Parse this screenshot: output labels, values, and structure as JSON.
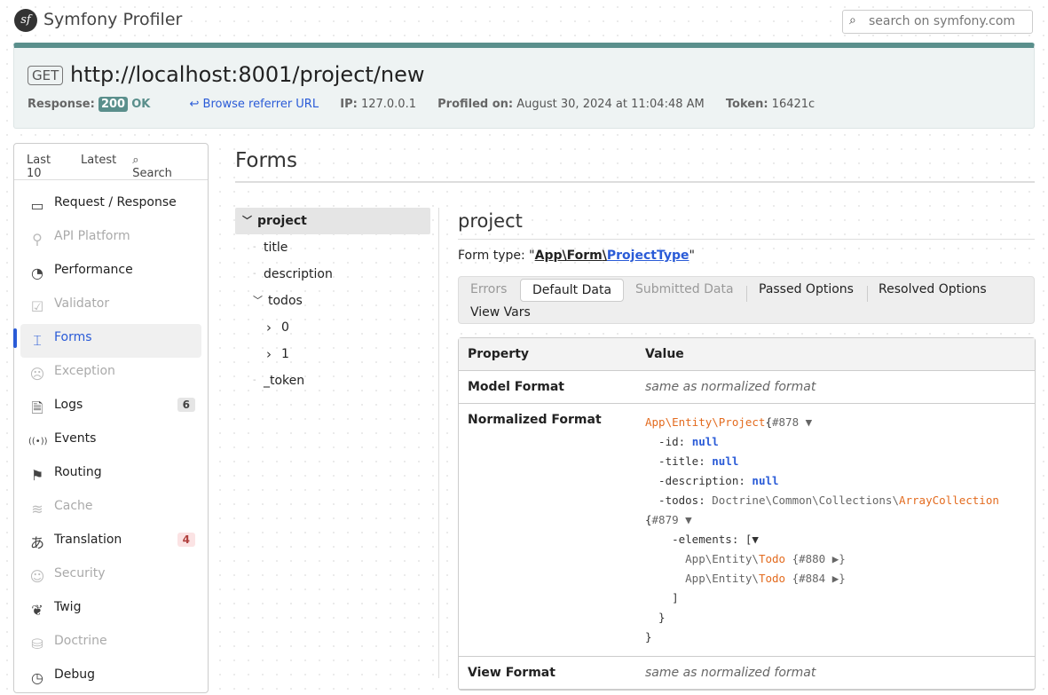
{
  "header": {
    "brand": "Symfony Profiler",
    "logo": "sf",
    "search_placeholder": "search on symfony.com"
  },
  "summary": {
    "method": "GET",
    "url": "http://localhost:8001/project/new",
    "response_label": "Response:",
    "status_code": "200",
    "status_text": "OK",
    "referrer": "Browse referrer URL",
    "ip_label": "IP:",
    "ip": "127.0.0.1",
    "profiled_label": "Profiled on:",
    "profiled": "August 30, 2024 at 11:04:48 AM",
    "token_label": "Token:",
    "token": "16421c",
    "accent": "#5a8f8c"
  },
  "sidebar": {
    "top": [
      "Last 10",
      "Latest",
      "Search"
    ],
    "items": [
      {
        "label": "Request / Response",
        "icon": "window-icon",
        "glyph": "▭",
        "state": "normal"
      },
      {
        "label": "API Platform",
        "icon": "spider-icon",
        "glyph": "⚲",
        "state": "disabled"
      },
      {
        "label": "Performance",
        "icon": "clock-chart-icon",
        "glyph": "◔",
        "state": "normal"
      },
      {
        "label": "Validator",
        "icon": "clipboard-check-icon",
        "glyph": "☑",
        "state": "disabled"
      },
      {
        "label": "Forms",
        "icon": "form-icon",
        "glyph": "⌶",
        "state": "selected"
      },
      {
        "label": "Exception",
        "icon": "ghost-icon",
        "glyph": "☹",
        "state": "disabled"
      },
      {
        "label": "Logs",
        "icon": "file-alert-icon",
        "glyph": "🗎",
        "state": "normal",
        "count": "6"
      },
      {
        "label": "Events",
        "icon": "broadcast-icon",
        "glyph": "((•))",
        "state": "normal"
      },
      {
        "label": "Routing",
        "icon": "signpost-icon",
        "glyph": "⚑",
        "state": "normal"
      },
      {
        "label": "Cache",
        "icon": "layers-icon",
        "glyph": "≋",
        "state": "disabled"
      },
      {
        "label": "Translation",
        "icon": "language-icon",
        "glyph": "あ",
        "state": "normal",
        "count": "4",
        "count_style": "red"
      },
      {
        "label": "Security",
        "icon": "user-icon",
        "glyph": "☺",
        "state": "disabled"
      },
      {
        "label": "Twig",
        "icon": "sprout-icon",
        "glyph": "❦",
        "state": "normal"
      },
      {
        "label": "Doctrine",
        "icon": "database-icon",
        "glyph": "⛁",
        "state": "disabled"
      },
      {
        "label": "Debug",
        "icon": "debug-icon",
        "glyph": "◷",
        "state": "normal"
      }
    ]
  },
  "main": {
    "title": "Forms",
    "tree": [
      {
        "label": "project",
        "level": 0,
        "toggle": "expanded",
        "selected": true
      },
      {
        "label": "title",
        "level": 1
      },
      {
        "label": "description",
        "level": 1
      },
      {
        "label": "todos",
        "level": 1,
        "toggle": "expanded"
      },
      {
        "label": "0",
        "level": 2,
        "toggle": "collapsed"
      },
      {
        "label": "1",
        "level": 2,
        "toggle": "collapsed"
      },
      {
        "label": "_token",
        "level": 1
      }
    ],
    "detail": {
      "title": "project",
      "form_type_label": "Form type: ",
      "form_type_parts": [
        "App",
        "Form",
        "ProjectType"
      ],
      "tabs": [
        {
          "label": "Errors",
          "state": "disabled"
        },
        {
          "label": "Default Data",
          "state": "active"
        },
        {
          "label": "Submitted Data",
          "state": "disabled"
        },
        {
          "label": "Passed Options",
          "state": "normal"
        },
        {
          "label": "Resolved Options",
          "state": "normal"
        },
        {
          "label": "View Vars",
          "state": "normal"
        }
      ],
      "table": {
        "headers": [
          "Property",
          "Value"
        ],
        "rows": [
          {
            "key": "Model Format",
            "value": "same as normalized format"
          },
          {
            "key": "Normalized Format",
            "dump": [
              [
                [
                  "cls",
                  "App\\Entity\\Project"
                ],
                [
                  "",
                  "{"
                ],
                [
                  "ref",
                  "#878 ▼"
                ]
              ],
              [
                [
                  "",
                  "  -id: "
                ],
                [
                  "null",
                  "null"
                ]
              ],
              [
                [
                  "",
                  "  -title: "
                ],
                [
                  "null",
                  "null"
                ]
              ],
              [
                [
                  "",
                  "  -description: "
                ],
                [
                  "null",
                  "null"
                ]
              ],
              [
                [
                  "",
                  "  -todos: "
                ],
                [
                  "ref",
                  "Doctrine\\Common\\Collections\\"
                ],
                [
                  "cls",
                  "ArrayCollection"
                ]
              ],
              [
                [
                  "",
                  "{"
                ],
                [
                  "ref",
                  "#879 ▼"
                ]
              ],
              [
                [
                  "",
                  "    -elements: [▼"
                ]
              ],
              [
                [
                  "ref",
                  "      App\\Entity\\"
                ],
                [
                  "cls",
                  "Todo"
                ],
                [
                  "",
                  ""
                ],
                [
                  "ref",
                  " {#880 ▶}"
                ]
              ],
              [
                [
                  "ref",
                  "      App\\Entity\\"
                ],
                [
                  "cls",
                  "Todo"
                ],
                [
                  "ref",
                  " {#884 ▶}"
                ]
              ],
              [
                [
                  "",
                  "    ]"
                ]
              ],
              [
                [
                  "",
                  "  }"
                ]
              ],
              [
                [
                  "",
                  "}"
                ]
              ]
            ]
          },
          {
            "key": "View Format",
            "value": "same as normalized format"
          }
        ]
      }
    }
  }
}
